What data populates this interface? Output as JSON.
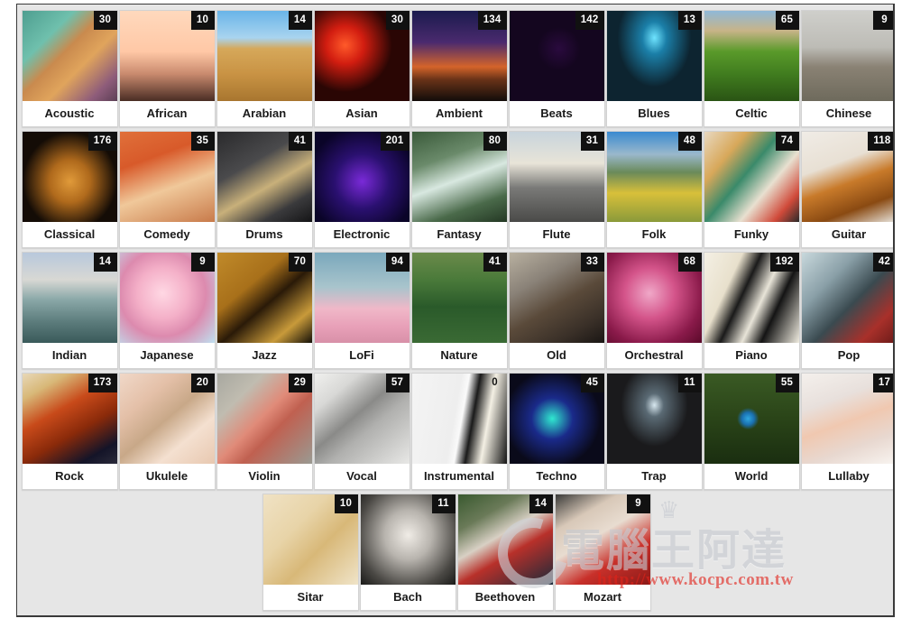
{
  "window": {
    "background_color": "#e6e6e6",
    "border_color": "#3a3a3a"
  },
  "badge": {
    "background_color": "#111111",
    "text_color": "#ffffff"
  },
  "watermark": {
    "crown": "♛",
    "brand": "電腦王阿達",
    "url": "http://www.kocpc.com.tw",
    "url_color": "#e2231a"
  },
  "grid": {
    "rows": [
      {
        "centered": false,
        "cards": [
          {
            "label": "Acoustic",
            "count": "30",
            "art": "acoustic-guitar"
          },
          {
            "label": "African",
            "count": "10",
            "art": "african-savannah"
          },
          {
            "label": "Arabian",
            "count": "14",
            "art": "desert-dune"
          },
          {
            "label": "Asian",
            "count": "30",
            "art": "red-lanterns"
          },
          {
            "label": "Ambient",
            "count": "134",
            "art": "sunset-mountains"
          },
          {
            "label": "Beats",
            "count": "142",
            "art": "dj-turntable"
          },
          {
            "label": "Blues",
            "count": "13",
            "art": "blue-spotlight"
          },
          {
            "label": "Celtic",
            "count": "65",
            "art": "green-hills"
          },
          {
            "label": "Chinese",
            "count": "9",
            "art": "pagoda"
          }
        ]
      },
      {
        "centered": false,
        "cards": [
          {
            "label": "Classical",
            "count": "176",
            "art": "cello"
          },
          {
            "label": "Comedy",
            "count": "35",
            "art": "clown-toy"
          },
          {
            "label": "Drums",
            "count": "41",
            "art": "drum-kit"
          },
          {
            "label": "Electronic",
            "count": "201",
            "art": "laser-show"
          },
          {
            "label": "Fantasy",
            "count": "80",
            "art": "fairy-forest"
          },
          {
            "label": "Flute",
            "count": "31",
            "art": "flute-player"
          },
          {
            "label": "Folk",
            "count": "48",
            "art": "autumn-mountains"
          },
          {
            "label": "Funky",
            "count": "74",
            "art": "collage-eye"
          },
          {
            "label": "Guitar",
            "count": "118",
            "art": "acoustic-guitar-body"
          }
        ]
      },
      {
        "centered": false,
        "cards": [
          {
            "label": "Indian",
            "count": "14",
            "art": "taj-mahal"
          },
          {
            "label": "Japanese",
            "count": "9",
            "art": "cherry-blossom"
          },
          {
            "label": "Jazz",
            "count": "70",
            "art": "jazz-silhouette"
          },
          {
            "label": "LoFi",
            "count": "94",
            "art": "pink-clouds"
          },
          {
            "label": "Nature",
            "count": "41",
            "art": "forest"
          },
          {
            "label": "Old",
            "count": "33",
            "art": "vintage-radio"
          },
          {
            "label": "Orchestral",
            "count": "68",
            "art": "conductor-pink"
          },
          {
            "label": "Piano",
            "count": "192",
            "art": "piano-keys"
          },
          {
            "label": "Pop",
            "count": "42",
            "art": "singer-smoke"
          }
        ]
      },
      {
        "centered": false,
        "cards": [
          {
            "label": "Rock",
            "count": "173",
            "art": "electric-guitar"
          },
          {
            "label": "Ukulele",
            "count": "20",
            "art": "ukulele-player"
          },
          {
            "label": "Violin",
            "count": "29",
            "art": "violin-wood"
          },
          {
            "label": "Vocal",
            "count": "57",
            "art": "studio-microphone"
          },
          {
            "label": "Instrumental",
            "count": "0",
            "art": "piano-white",
            "badge_ghost": true
          },
          {
            "label": "Techno",
            "count": "45",
            "art": "neon-lasers"
          },
          {
            "label": "Trap",
            "count": "11",
            "art": "hooded-mask"
          },
          {
            "label": "World",
            "count": "55",
            "art": "globe-grass"
          },
          {
            "label": "Lullaby",
            "count": "17",
            "art": "sleeping-baby"
          }
        ]
      },
      {
        "centered": true,
        "cards": [
          {
            "label": "Sitar",
            "count": "10",
            "art": "sitar"
          },
          {
            "label": "Bach",
            "count": "11",
            "art": "bach-portrait"
          },
          {
            "label": "Beethoven",
            "count": "14",
            "art": "beethoven-portrait"
          },
          {
            "label": "Mozart",
            "count": "9",
            "art": "mozart-portrait"
          }
        ]
      }
    ]
  }
}
